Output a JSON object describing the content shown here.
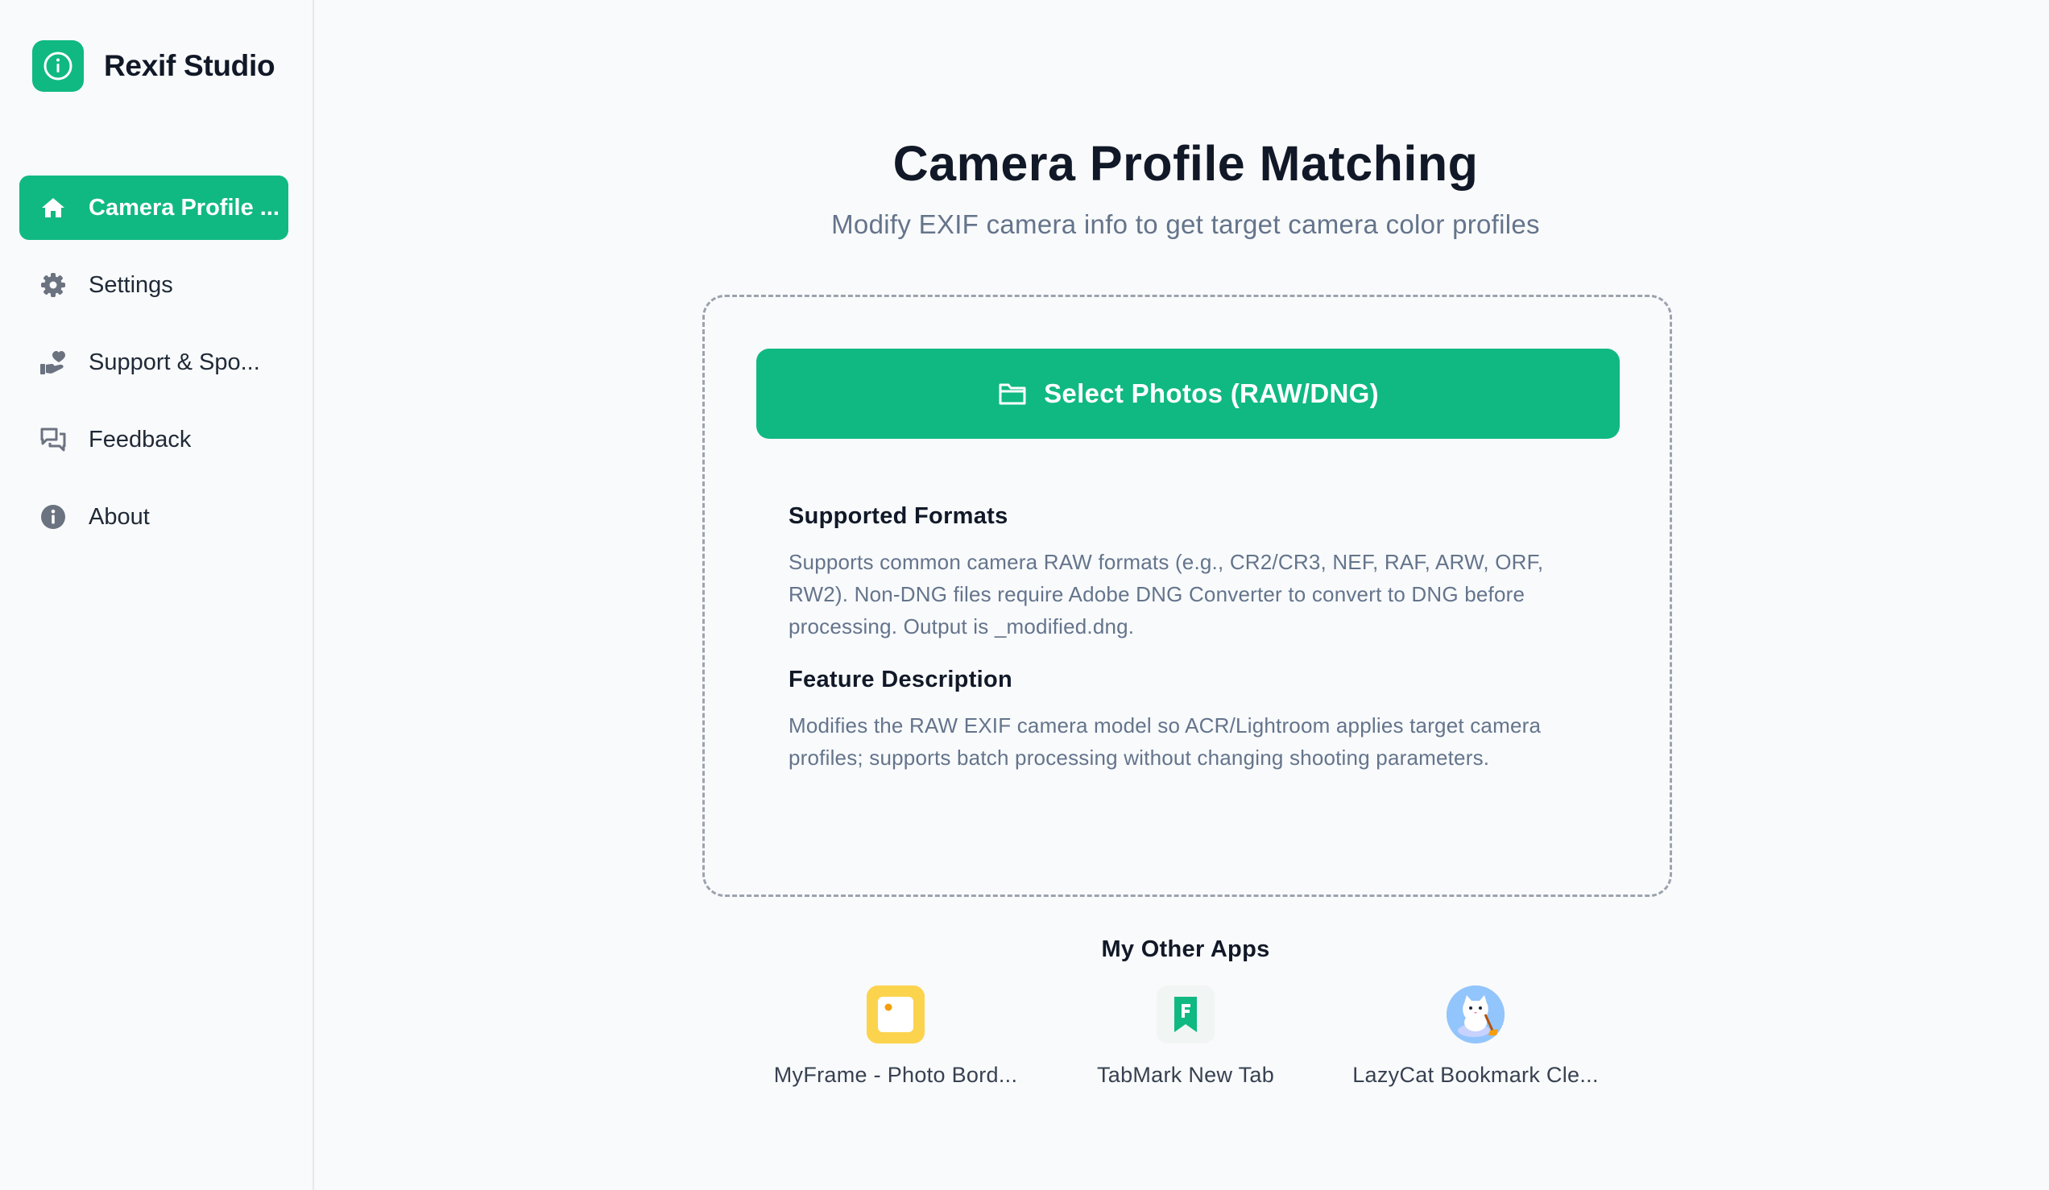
{
  "app": {
    "name": "Rexif Studio",
    "accent_color": "#10b981",
    "logo_icon": "info-circle-icon"
  },
  "sidebar": {
    "items": [
      {
        "label": "Camera Profile ...",
        "icon": "home-icon",
        "active": true
      },
      {
        "label": "Settings",
        "icon": "gear-icon",
        "active": false
      },
      {
        "label": "Support & Spo...",
        "icon": "hand-heart-icon",
        "active": false
      },
      {
        "label": "Feedback",
        "icon": "chat-bubbles-icon",
        "active": false
      },
      {
        "label": "About",
        "icon": "info-icon",
        "active": false
      }
    ]
  },
  "main": {
    "title": "Camera Profile Matching",
    "subtitle": "Modify EXIF camera info to get target camera color profiles",
    "select_button": {
      "label": "Select Photos (RAW/DNG)",
      "icon": "folder-icon"
    },
    "info": {
      "formats_heading": "Supported Formats",
      "formats_text": "Supports common camera RAW formats (e.g., CR2/CR3, NEF, RAF, ARW, ORF, RW2). Non-DNG files require Adobe DNG Converter to convert to DNG before processing. Output is _modified.dng.",
      "feature_heading": "Feature Description",
      "feature_text": "Modifies the RAW EXIF camera model so ACR/Lightroom applies target camera profiles; supports batch processing without changing shooting parameters."
    },
    "other_apps": {
      "title": "My Other Apps",
      "apps": [
        {
          "name": "MyFrame - Photo Bord...",
          "icon": "myframe-app-icon"
        },
        {
          "name": "TabMark New Tab",
          "icon": "tabmark-app-icon"
        },
        {
          "name": "LazyCat Bookmark Cle...",
          "icon": "lazycat-app-icon"
        }
      ]
    }
  }
}
